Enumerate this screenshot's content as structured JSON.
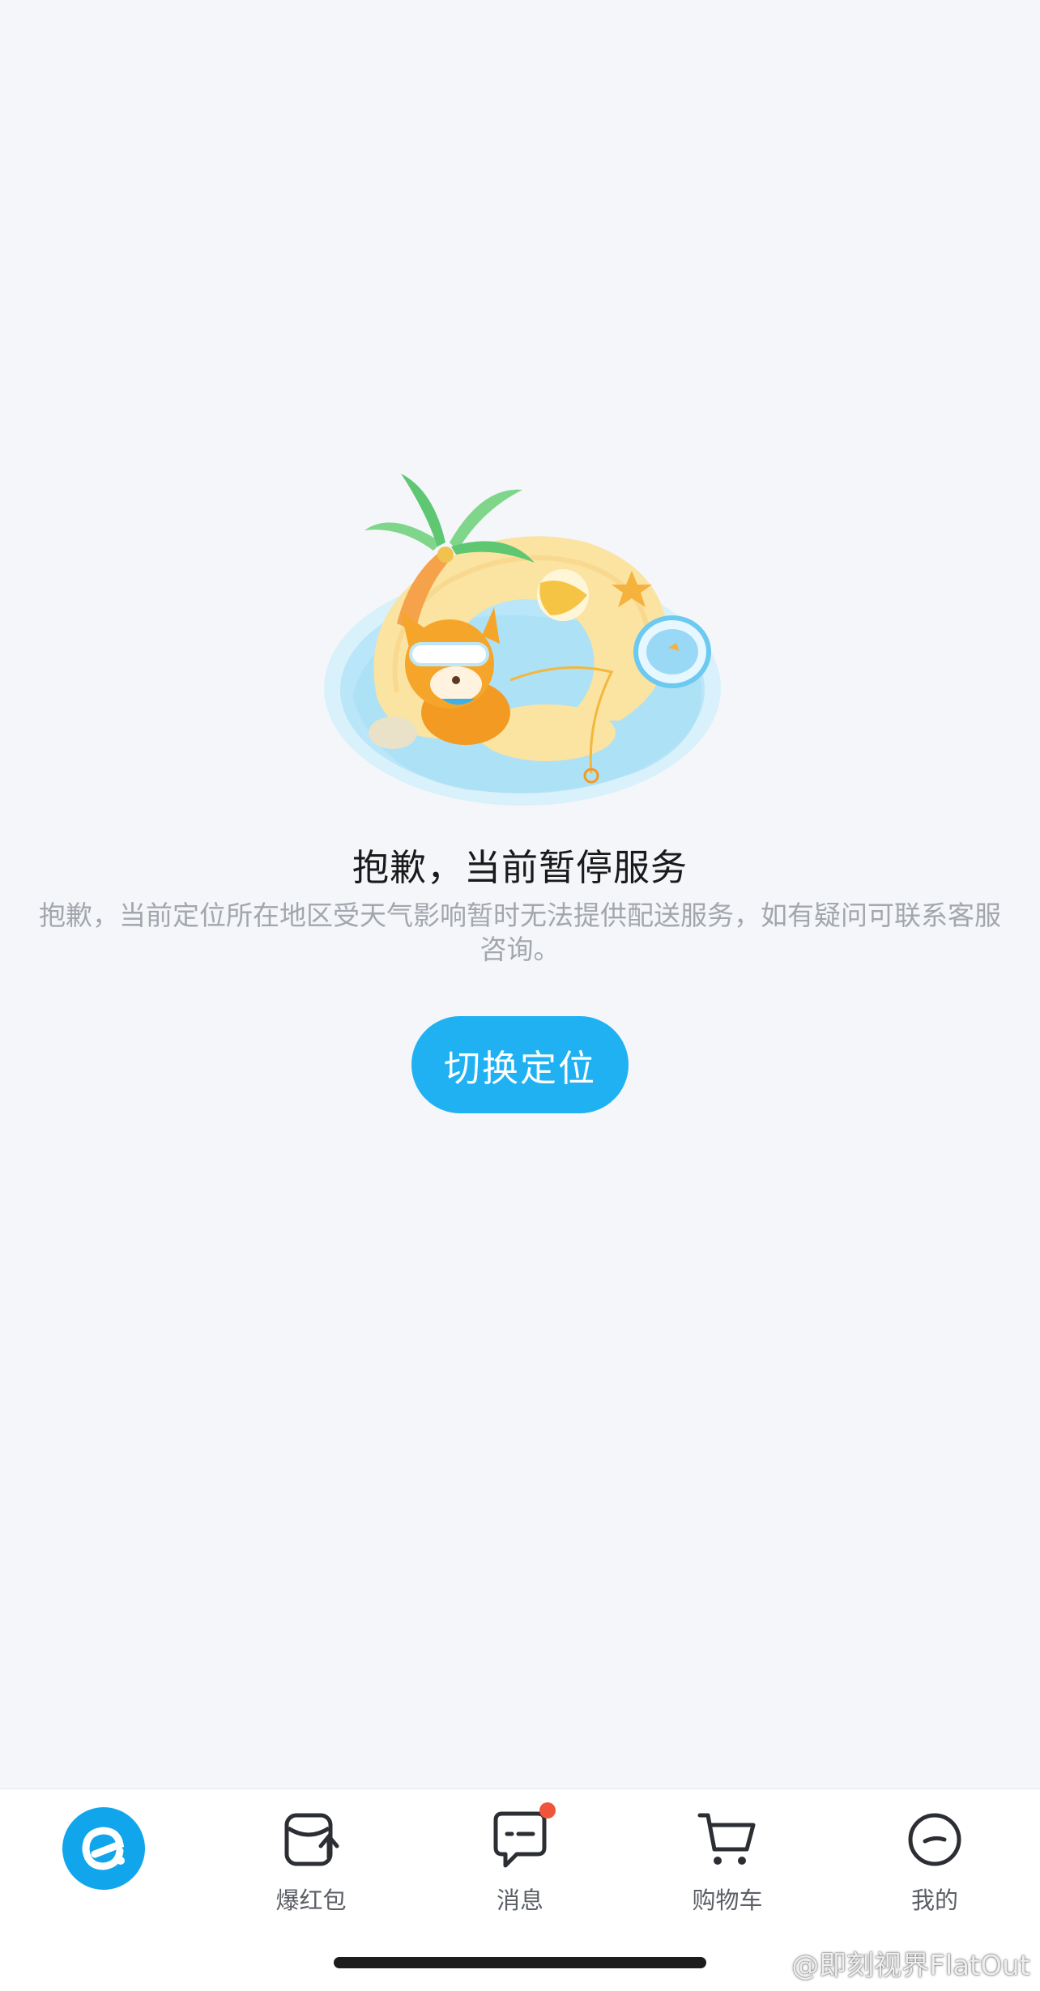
{
  "empty_state": {
    "title": "抱歉，当前暂停服务",
    "description": "抱歉，当前定位所在地区受天气影响暂时无法提供配送服务，如有疑问可联系客服咨询。",
    "button_label": "切换定位"
  },
  "tabbar": {
    "tabs": [
      {
        "label": "",
        "icon": "eleme-home-logo"
      },
      {
        "label": "爆红包",
        "icon": "red-packet-icon"
      },
      {
        "label": "消息",
        "icon": "message-icon",
        "badge": true
      },
      {
        "label": "购物车",
        "icon": "cart-icon"
      },
      {
        "label": "我的",
        "icon": "profile-face-icon"
      }
    ]
  },
  "watermark": "@即刻视界FlatOut",
  "colors": {
    "accent": "#1fb1f2",
    "background": "#f4f6fa",
    "badge": "#f0543c"
  }
}
